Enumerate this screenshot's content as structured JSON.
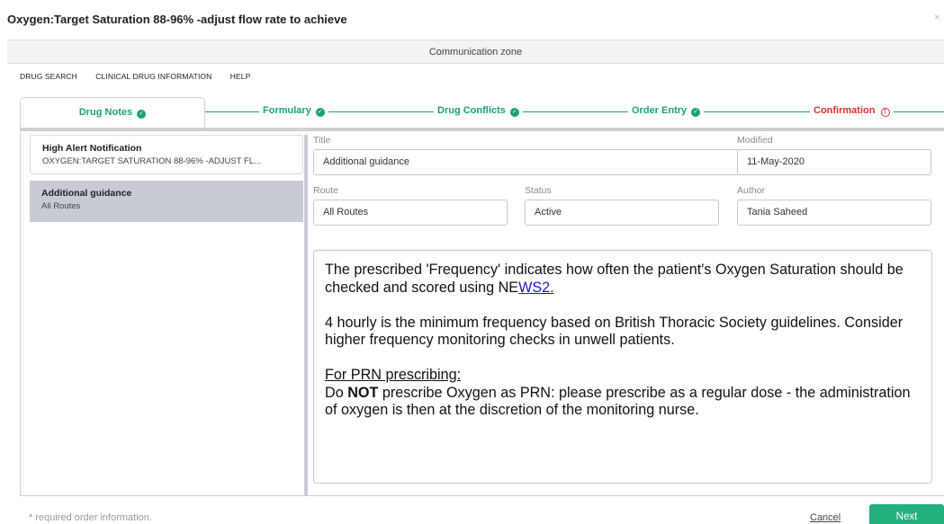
{
  "window": {
    "title": "Oxygen:Target Saturation 88-96% -adjust flow rate to achieve",
    "close_glyph": "×"
  },
  "communication_zone": "Communication zone",
  "menu": [
    "DRUG SEARCH",
    "CLINICAL DRUG INFORMATION",
    "HELP"
  ],
  "steps": {
    "drug_notes": "Drug Notes",
    "formulary": "Formulary",
    "drug_conflicts": "Drug Conflicts",
    "order_entry": "Order Entry",
    "confirmation": "Confirmation"
  },
  "notes_list": [
    {
      "title": "High Alert Notification",
      "subtitle": "OXYGEN:TARGET SATURATION 88-96% -ADJUST FL..."
    },
    {
      "title": "Additional guidance",
      "subtitle": "All Routes"
    }
  ],
  "form": {
    "title_label": "Title",
    "title_value": "Additional guidance",
    "modified_label": "Modified",
    "modified_value": "11-May-2020",
    "route_label": "Route",
    "route_value": "All Routes",
    "status_label": "Status",
    "status_value": "Active",
    "author_label": "Author",
    "author_value": "Tania Saheed"
  },
  "guidance": {
    "para1_pre": "The prescribed 'Frequency' indicates how often the patient's Oxygen Saturation should be checked and scored using NE",
    "para1_link": "WS2.",
    "para2": "4 hourly is the minimum frequency based on British Thoracic Society guidelines. Consider higher frequency monitoring checks in unwell patients.",
    "prn_heading": "For PRN prescribing:",
    "prn_pre": "Do ",
    "prn_bold": "NOT",
    "prn_post": " prescribe Oxygen as PRN: please prescribe as a regular dose - the administration of oxygen is then at the discretion of the monitoring nurse."
  },
  "footer": {
    "note": "* required order information.",
    "cancel": "Cancel",
    "next": "Next"
  },
  "colors": {
    "accent_green": "#1aa178",
    "error_red": "#e03030",
    "selected_bg": "#c7cbd3",
    "link_blue": "#1a1ad8"
  },
  "icons": {
    "step_complete": "check-circle-icon",
    "step_warning": "exclamation-circle-icon"
  }
}
